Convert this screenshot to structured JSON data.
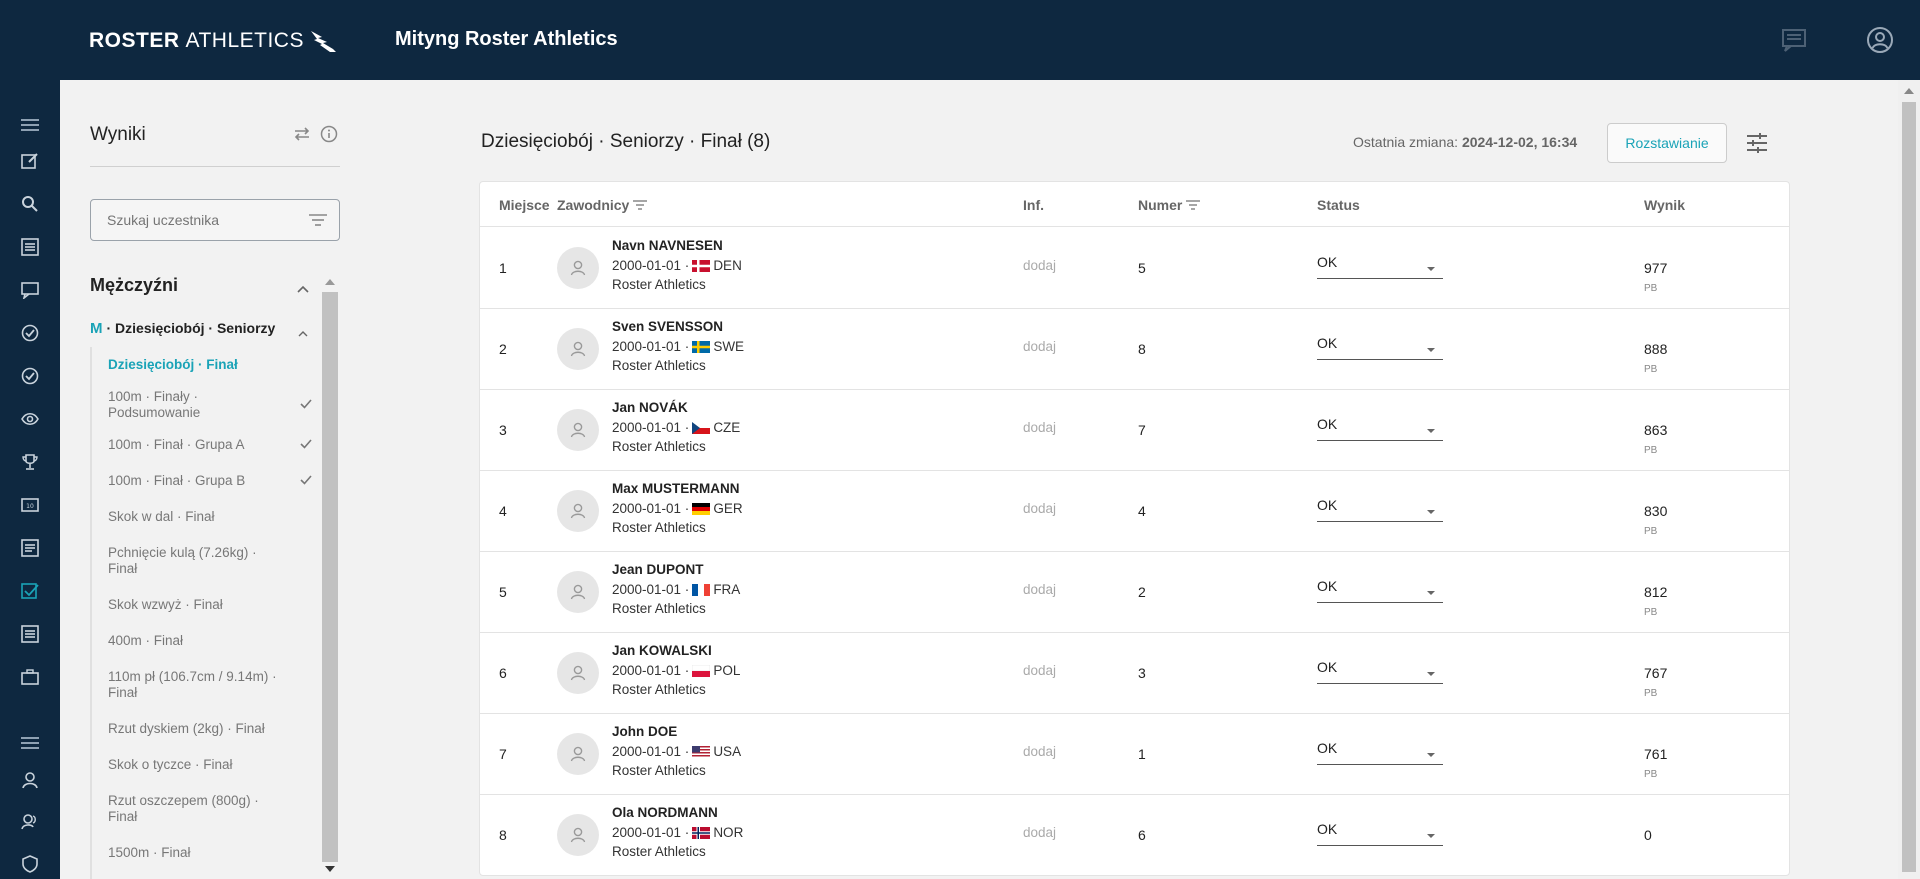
{
  "header": {
    "logo_bold": "ROSTER",
    "logo_light": "ATHLETICS",
    "meet_title": "Mityng Roster Athletics",
    "icons": [
      "chat-icon",
      "account-icon"
    ]
  },
  "rail": {
    "icons": [
      "menu-icon",
      "edit-icon",
      "search-icon",
      "list-icon",
      "chat-icon",
      "check-circle-icon",
      "check-circle-outline-icon",
      "eye-icon",
      "trophy-icon",
      "scoreboard-icon",
      "document-icon",
      "checkbox-icon",
      "list-alt-icon",
      "briefcase-icon",
      "menu-icon",
      "person-icon",
      "support-icon",
      "shield-icon"
    ]
  },
  "left_panel": {
    "title": "Wyniki",
    "search_placeholder": "Szukaj uczestnika",
    "group_title": "Mężczyźni",
    "sub_prefix": "M",
    "sub_title": "· Dziesięciobój · Seniorzy",
    "events": [
      {
        "label": "Dziesięciobój · Finał",
        "active": true,
        "check": false
      },
      {
        "label": "100m · Finały · Podsumowanie",
        "active": false,
        "check": true
      },
      {
        "label": "100m · Finał · Grupa A",
        "active": false,
        "check": true
      },
      {
        "label": "100m · Finał · Grupa B",
        "active": false,
        "check": true
      },
      {
        "label": "Skok w dal · Finał",
        "active": false,
        "check": false
      },
      {
        "label": "Pchnięcie kulą (7.26kg) · Finał",
        "active": false,
        "check": false
      },
      {
        "label": "Skok wzwyż · Finał",
        "active": false,
        "check": false
      },
      {
        "label": "400m · Finał",
        "active": false,
        "check": false
      },
      {
        "label": "110m pł (106.7cm / 9.14m) · Finał",
        "active": false,
        "check": false
      },
      {
        "label": "Rzut dyskiem (2kg) · Finał",
        "active": false,
        "check": false
      },
      {
        "label": "Skok o tyczce · Finał",
        "active": false,
        "check": false
      },
      {
        "label": "Rzut oszczepem (800g) · Finał",
        "active": false,
        "check": false
      },
      {
        "label": "1500m · Finał",
        "active": false,
        "check": false
      }
    ]
  },
  "main": {
    "title": "Dziesięciobój · Seniorzy · Finał (8)",
    "last_change_label": "Ostatnia zmiana:",
    "last_change_value": "2024-12-02, 16:34",
    "button_label": "Rozstawianie",
    "columns": {
      "place": "Miejsce",
      "athletes": "Zawodnicy",
      "info": "Inf.",
      "number": "Numer",
      "status": "Status",
      "result": "Wynik"
    },
    "rows": [
      {
        "place": "1",
        "name": "Navn NAVNESEN",
        "dob": "2000-01-01 ·",
        "country": "DEN",
        "club": "Roster Athletics",
        "info": "dodaj",
        "number": "5",
        "status": "OK",
        "result": "977",
        "pb": "PB"
      },
      {
        "place": "2",
        "name": "Sven SVENSSON",
        "dob": "2000-01-01 ·",
        "country": "SWE",
        "club": "Roster Athletics",
        "info": "dodaj",
        "number": "8",
        "status": "OK",
        "result": "888",
        "pb": "PB"
      },
      {
        "place": "3",
        "name": "Jan NOVÁK",
        "dob": "2000-01-01 ·",
        "country": "CZE",
        "club": "Roster Athletics",
        "info": "dodaj",
        "number": "7",
        "status": "OK",
        "result": "863",
        "pb": "PB"
      },
      {
        "place": "4",
        "name": "Max MUSTERMANN",
        "dob": "2000-01-01 ·",
        "country": "GER",
        "club": "Roster Athletics",
        "info": "dodaj",
        "number": "4",
        "status": "OK",
        "result": "830",
        "pb": "PB"
      },
      {
        "place": "5",
        "name": "Jean DUPONT",
        "dob": "2000-01-01 ·",
        "country": "FRA",
        "club": "Roster Athletics",
        "info": "dodaj",
        "number": "2",
        "status": "OK",
        "result": "812",
        "pb": "PB"
      },
      {
        "place": "6",
        "name": "Jan KOWALSKI",
        "dob": "2000-01-01 ·",
        "country": "POL",
        "club": "Roster Athletics",
        "info": "dodaj",
        "number": "3",
        "status": "OK",
        "result": "767",
        "pb": "PB"
      },
      {
        "place": "7",
        "name": "John DOE",
        "dob": "2000-01-01 ·",
        "country": "USA",
        "club": "Roster Athletics",
        "info": "dodaj",
        "number": "1",
        "status": "OK",
        "result": "761",
        "pb": "PB"
      },
      {
        "place": "8",
        "name": "Ola NORDMANN",
        "dob": "2000-01-01 ·",
        "country": "NOR",
        "club": "Roster Athletics",
        "info": "dodaj",
        "number": "6",
        "status": "OK",
        "result": "0",
        "pb": ""
      }
    ]
  },
  "colors": {
    "nav": "#0e2840",
    "accent": "#1aa3b7"
  }
}
